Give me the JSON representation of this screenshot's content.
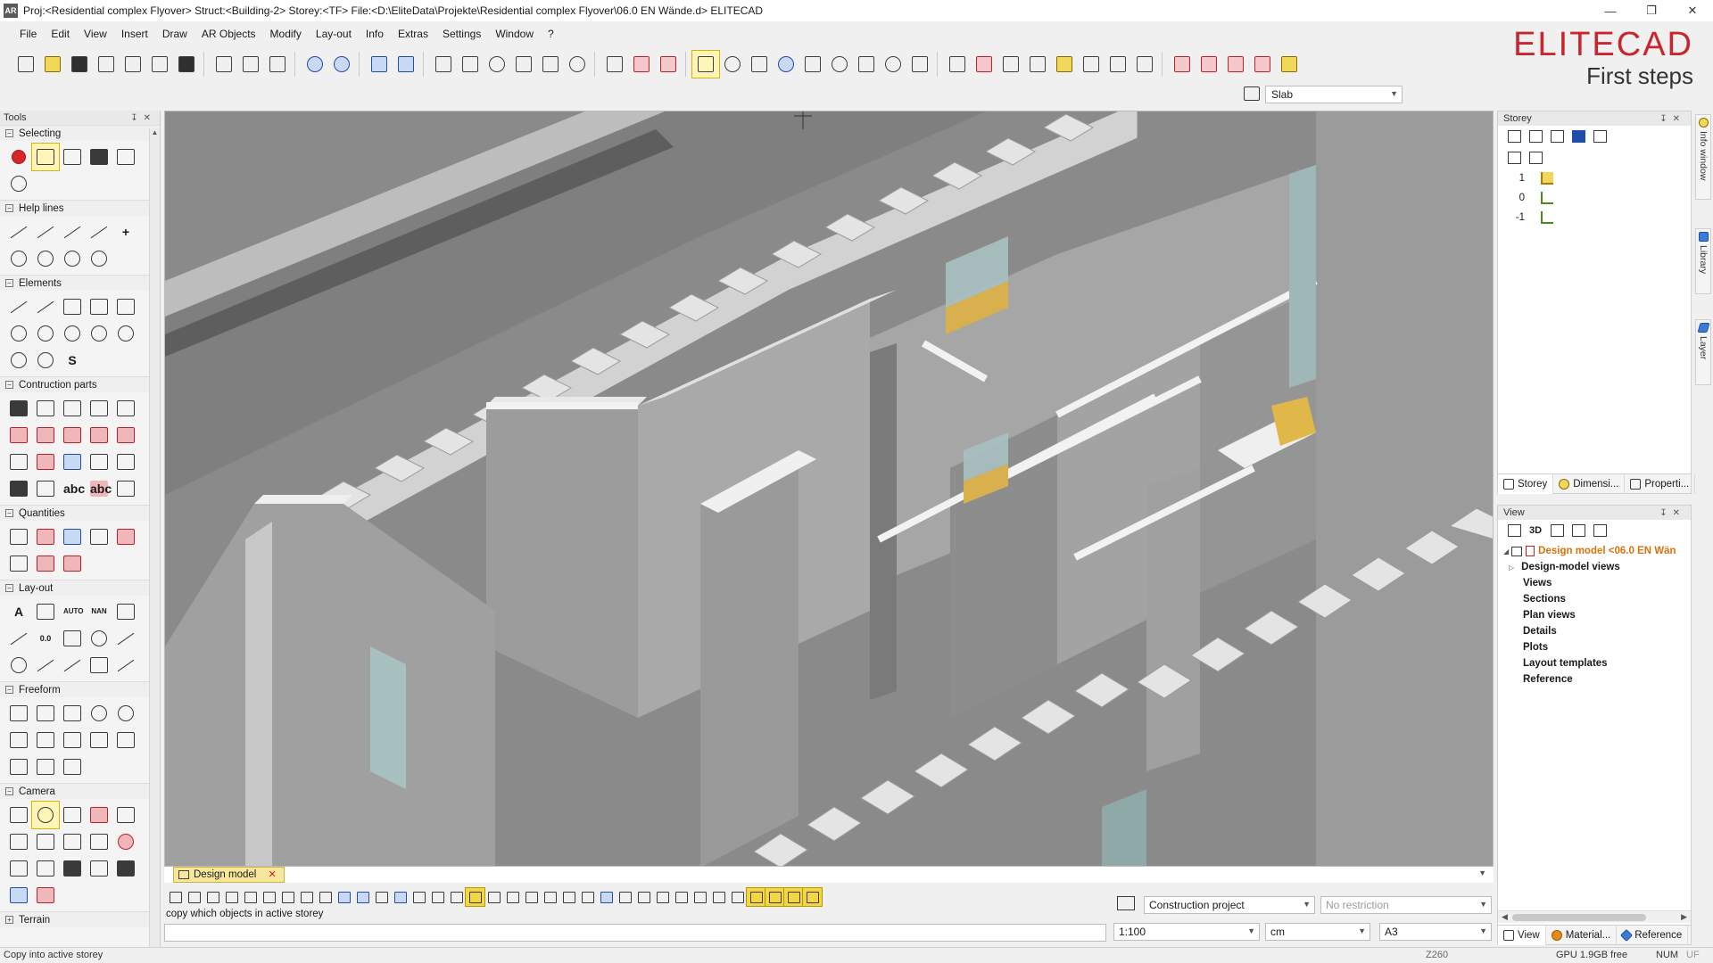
{
  "window": {
    "app_icon": "AR",
    "title": "Proj:<Residential complex Flyover>  Struct:<Building-2>  Storey:<TF>  File:<D:\\EliteData\\Projekte\\Residential complex Flyover\\06.0 EN Wände.d>  ELITECAD"
  },
  "menu": [
    "File",
    "Edit",
    "View",
    "Insert",
    "Draw",
    "AR Objects",
    "Modify",
    "Lay-out",
    "Info",
    "Extras",
    "Settings",
    "Window",
    "?"
  ],
  "brand": {
    "logo": "ELITECAD",
    "subtitle": "First steps"
  },
  "layer_select": {
    "value": "Slab"
  },
  "tools_panel": {
    "title": "Tools",
    "sections": [
      {
        "name": "Selecting"
      },
      {
        "name": "Help lines"
      },
      {
        "name": "Elements"
      },
      {
        "name": "Contruction parts"
      },
      {
        "name": "Quantities"
      },
      {
        "name": "Lay-out"
      },
      {
        "name": "Freeform"
      },
      {
        "name": "Camera"
      },
      {
        "name": "Terrain"
      }
    ],
    "layout_texts": {
      "a": "A",
      "auto": "AUTO",
      "nan": "NAN",
      "num": "0.0",
      "abc": "abc",
      "abc2": "abc"
    }
  },
  "viewport_tab": {
    "label": "Design model"
  },
  "command": {
    "prompt": "copy which objects in active storey",
    "value": ""
  },
  "bottom_fields": {
    "project": "Construction project",
    "restriction_placeholder": "No restriction",
    "scale": "1:100",
    "unit": "cm",
    "paper": "A3"
  },
  "status": {
    "text": "Copy into active storey",
    "coord": "Z260",
    "gpu": "GPU 1.9GB free",
    "num": "NUM",
    "uf": "UF"
  },
  "storey_panel": {
    "title": "Storey",
    "rows": [
      {
        "num": "1",
        "active": true
      },
      {
        "num": "0",
        "active": false
      },
      {
        "num": "-1",
        "active": false
      }
    ],
    "tabs": [
      "Storey",
      "Dimensi...",
      "Properti..."
    ]
  },
  "view_panel": {
    "title": "View",
    "toolbar_3d": "3D",
    "tree_root": "Design model <06.0 EN Wän",
    "tree_items": [
      "Design-model views",
      "Views",
      "Sections",
      "Plan views",
      "Details",
      "Plots",
      "Layout templates",
      "Reference"
    ],
    "tabs": [
      "View",
      "Material...",
      "Reference"
    ]
  },
  "side_tabs": [
    "Info window",
    "Library",
    "Layer"
  ]
}
